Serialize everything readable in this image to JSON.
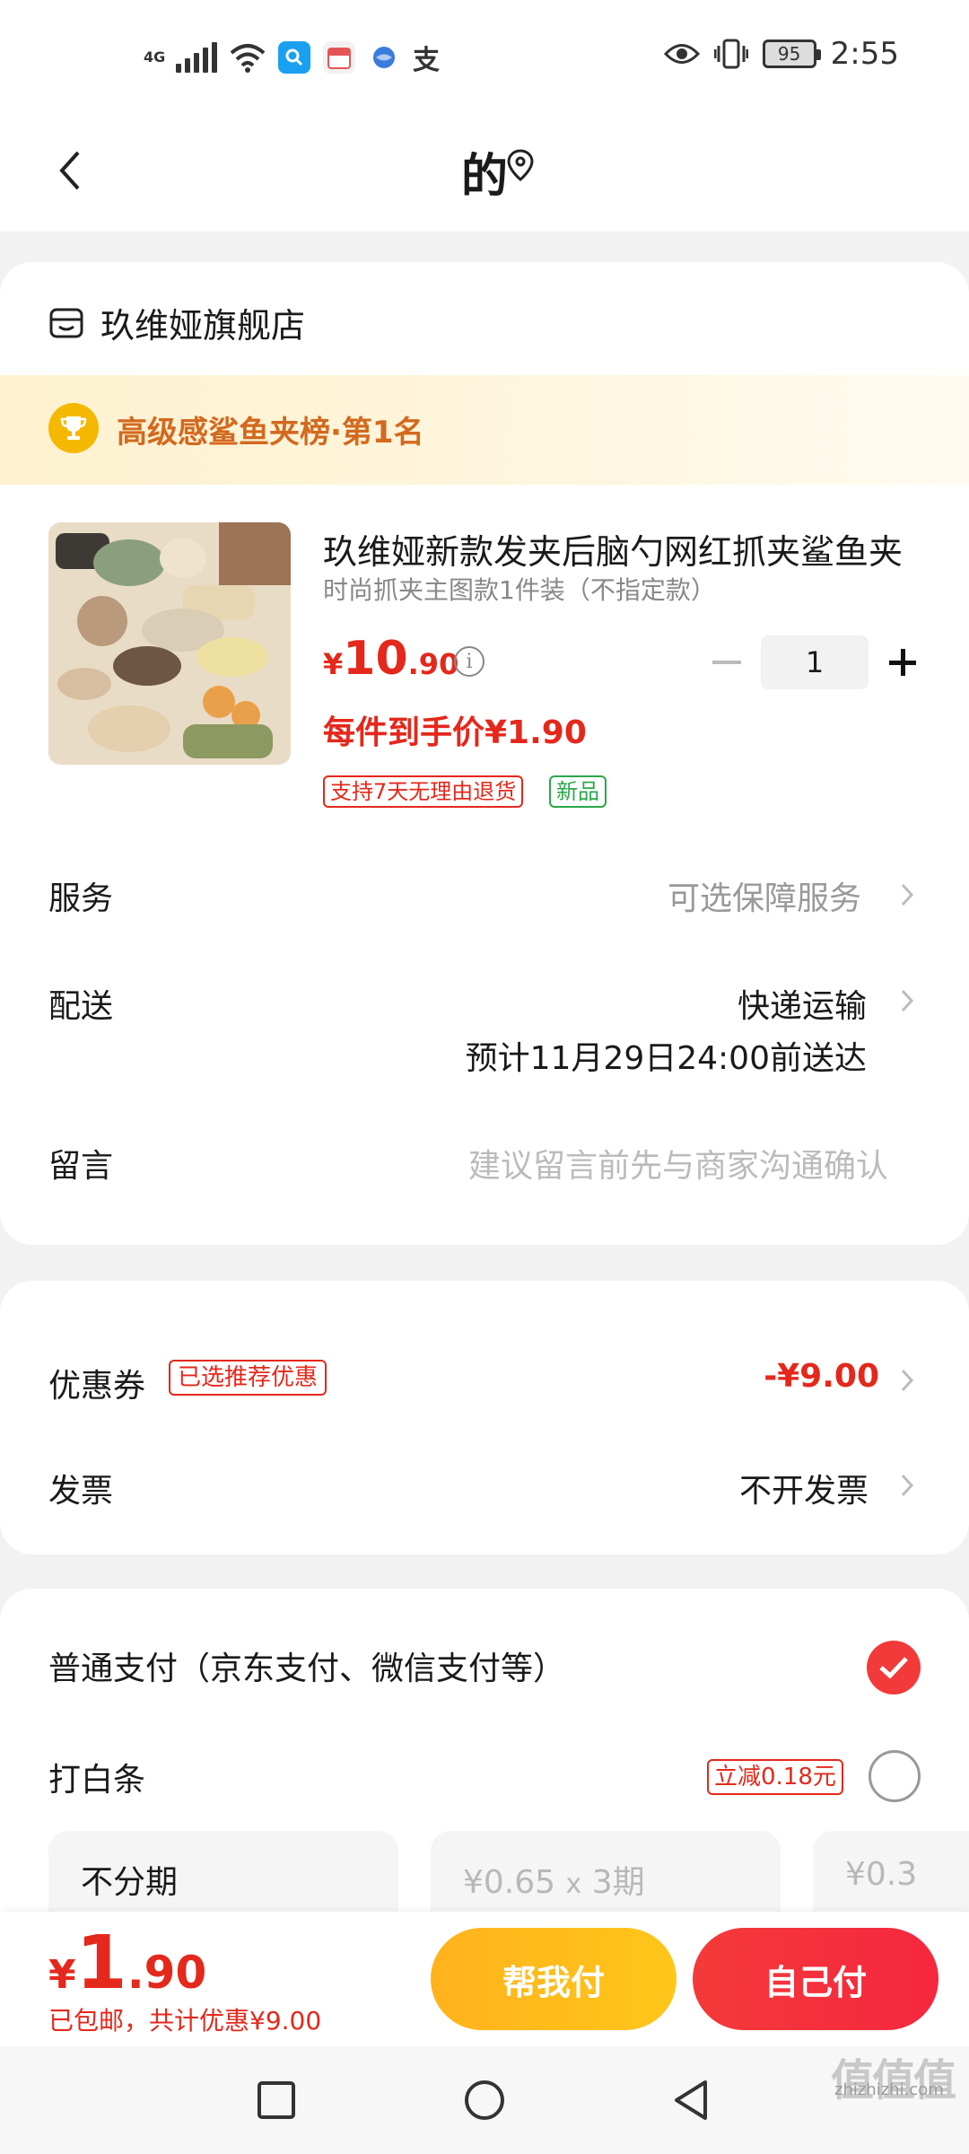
{
  "status_bar": {
    "network": "4G",
    "time": "2:55",
    "battery": "95",
    "icons": [
      "signal-icon",
      "wifi-icon",
      "search-app-icon",
      "calendar-app-icon",
      "browser-app-icon",
      "alipay-icon",
      "eye-icon",
      "vibrate-icon",
      "battery-icon"
    ]
  },
  "header": {
    "title": "的"
  },
  "shop": {
    "name": "玖维娅旗舰店"
  },
  "ranking": {
    "text": "高级感鲨鱼夹榜·第1名"
  },
  "product": {
    "title": "玖维娅新款发夹后脑勺网红抓夹鲨鱼夹",
    "sku": "时尚抓夹主图款1件装（不指定款）",
    "price_currency": "¥",
    "price_int": "10",
    "price_dec": ".90",
    "each_price": "每件到手价¥1.90",
    "quantity": "1",
    "tags": [
      "支持7天无理由退货",
      "新品"
    ]
  },
  "rows": {
    "service_label": "服务",
    "service_value": "可选保障服务",
    "delivery_label": "配送",
    "delivery_value": "快递运输",
    "delivery_eta": "预计11月29日24:00前送达",
    "message_label": "留言",
    "message_placeholder": "建议留言前先与商家沟通确认"
  },
  "coupon": {
    "label": "优惠券",
    "tag": "已选推荐优惠",
    "value": "-¥9.00"
  },
  "invoice": {
    "label": "发票",
    "value": "不开发票"
  },
  "payment": {
    "normal_label": "普通支付（京东支付、微信支付等）",
    "baitiao_label": "打白条",
    "baitiao_promo": "立减0.18元",
    "plans": [
      {
        "label": "不分期"
      },
      {
        "amount": "¥0.65",
        "x": "x",
        "periods": "3期"
      },
      {
        "amount": "¥0.3"
      }
    ]
  },
  "bottom": {
    "currency": "¥",
    "total_int": "1",
    "total_dec": ".90",
    "sub": "已包邮，共计优惠¥9.00",
    "help_pay": "帮我付",
    "self_pay": "自己付"
  },
  "watermark": {
    "logo": "值值值",
    "domain": "zhizhizhi.com"
  },
  "colors": {
    "accent_red": "#e4281b",
    "button_red": "#f33a3a",
    "button_yellow": "#ffb21c",
    "rank_orange": "#d2691e"
  }
}
